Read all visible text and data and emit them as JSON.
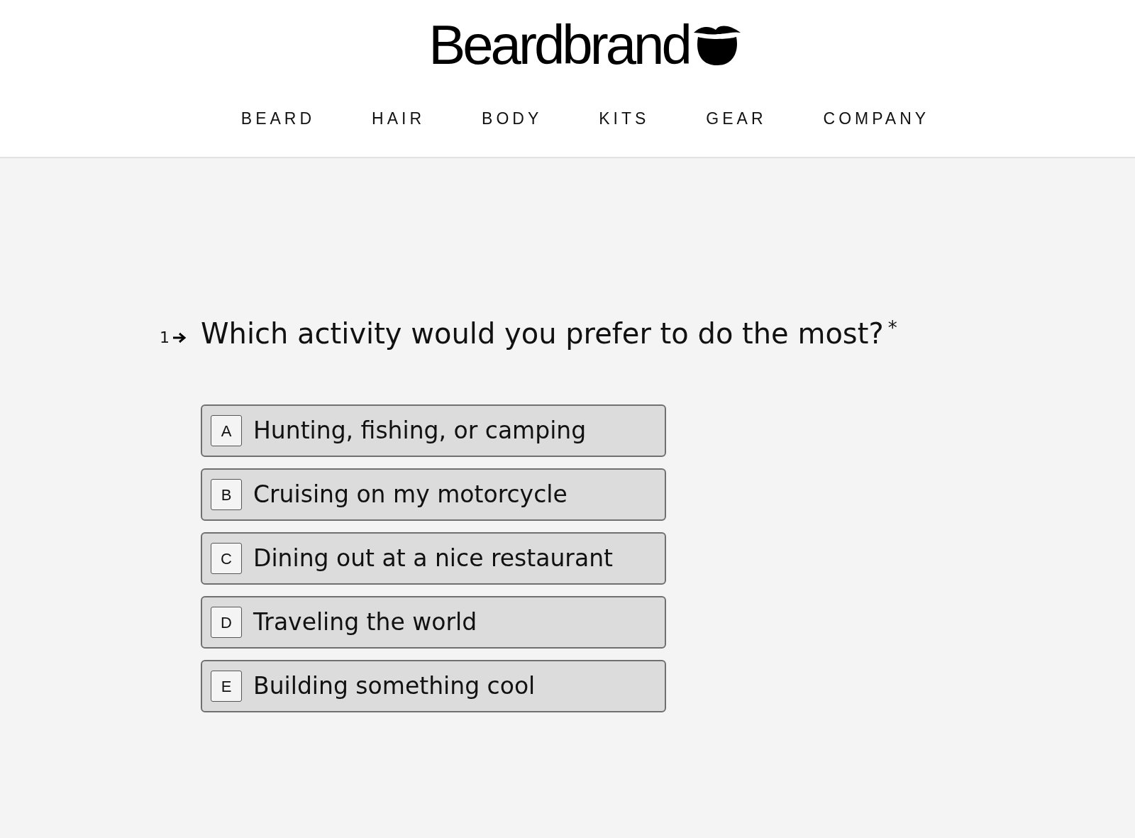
{
  "header": {
    "logo": "Beardbrand",
    "nav": [
      {
        "label": "BEARD"
      },
      {
        "label": "HAIR"
      },
      {
        "label": "BODY"
      },
      {
        "label": "KITS"
      },
      {
        "label": "GEAR"
      },
      {
        "label": "COMPANY"
      }
    ]
  },
  "question": {
    "number": "1",
    "text": "Which activity would you prefer to do the most?",
    "required_mark": "*",
    "choices": [
      {
        "key": "A",
        "label": "Hunting, fishing, or camping",
        "selected": false
      },
      {
        "key": "B",
        "label": "Cruising on my motorcycle",
        "selected": false
      },
      {
        "key": "C",
        "label": "Dining out at a nice restaurant",
        "selected": false
      },
      {
        "key": "D",
        "label": "Traveling the world",
        "selected": false
      },
      {
        "key": "E",
        "label": "Building something cool",
        "selected": false
      }
    ]
  }
}
